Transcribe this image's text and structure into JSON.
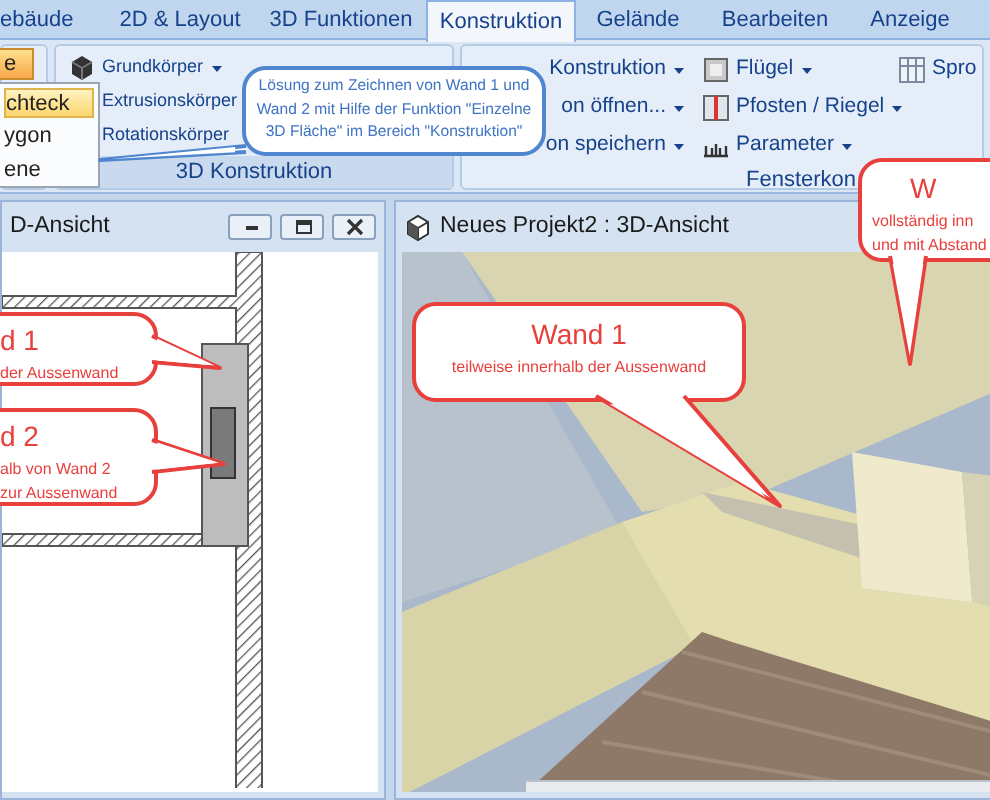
{
  "tabs": [
    {
      "label": "ebäude",
      "selected": false
    },
    {
      "label": "2D & Layout",
      "selected": false
    },
    {
      "label": "3D Funktionen",
      "selected": false
    },
    {
      "label": "Konstruktion",
      "selected": true
    },
    {
      "label": "Gelände",
      "selected": false
    },
    {
      "label": "Bearbeiten",
      "selected": false
    },
    {
      "label": "Anzeige",
      "selected": false
    }
  ],
  "ribbon": {
    "menu_button": "e",
    "menu": [
      {
        "label": "chteck",
        "selected": true
      },
      {
        "label": "ygon",
        "selected": false
      },
      {
        "label": "ene",
        "selected": false
      }
    ],
    "groups": [
      {
        "label": "3D Konstruktion",
        "columns": [
          [
            {
              "label": "Grundkörper",
              "dropdown": true
            },
            {
              "label": "Extrusionskörper",
              "dropdown": false
            },
            {
              "label": "Rotationskörper",
              "dropdown": false
            }
          ]
        ]
      },
      {
        "label": "Fensterkon",
        "columns": [
          [
            {
              "label": "Konstruktion",
              "dropdown": true
            },
            {
              "label": "on öffnen...",
              "dropdown": true
            },
            {
              "label": "on speichern",
              "dropdown": true
            }
          ],
          [
            {
              "label": "Flügel",
              "dropdown": true
            },
            {
              "label": "Pfosten / Riegel",
              "dropdown": true
            },
            {
              "label": "Parameter",
              "dropdown": true
            }
          ],
          [
            {
              "label": "Spro",
              "dropdown": false
            }
          ]
        ]
      }
    ]
  },
  "plan_window": {
    "title": "D-Ansicht"
  },
  "view_window": {
    "title": "Neues Projekt2 : 3D-Ansicht"
  },
  "callouts": [
    {
      "kind": "note",
      "lines": [
        "Lösung zum Zeichnen von Wand 1 und",
        "Wand 2 mit Hilfe der Funktion \"Einzelne",
        "3D Fläche\" im Bereich \"Konstruktion\""
      ]
    },
    {
      "kind": "label",
      "title": "W",
      "lines": [
        "vollständig inn",
        "und mit Abstand"
      ]
    },
    {
      "kind": "label",
      "title": "d 1",
      "lines": [
        "der Aussenwand"
      ]
    },
    {
      "kind": "label",
      "title": "Wand 1",
      "lines": [
        "teilweise innerhalb der Aussenwand"
      ]
    },
    {
      "kind": "label",
      "title": "d 2",
      "lines": [
        "alb von Wand 2",
        "zur Aussenwand"
      ]
    }
  ]
}
